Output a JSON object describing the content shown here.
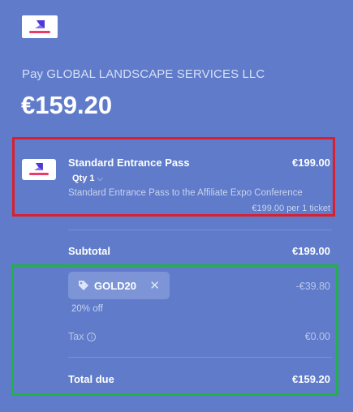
{
  "merchant": {
    "pay_label": "Pay GLOBAL LANDSCAPE SERVICES LLC"
  },
  "amount_due": "€159.20",
  "line_item": {
    "name": "Standard Entrance Pass",
    "price": "€199.00",
    "qty_label": "Qty 1",
    "description": "Standard Entrance Pass to the Affiliate Expo Conference",
    "unit_price": "€199.00 per 1 ticket"
  },
  "summary": {
    "subtotal_label": "Subtotal",
    "subtotal_value": "€199.00",
    "promo_code": "GOLD20",
    "discount_value": "-€39.80",
    "discount_pct": "20% off",
    "tax_label": "Tax",
    "tax_value": "€0.00",
    "total_label": "Total due",
    "total_value": "€159.20"
  },
  "colors": {
    "background": "#5f7bc9",
    "highlight_red": "#d8202f",
    "highlight_green": "#22b04b",
    "logo_accent": "#e83c6b"
  }
}
